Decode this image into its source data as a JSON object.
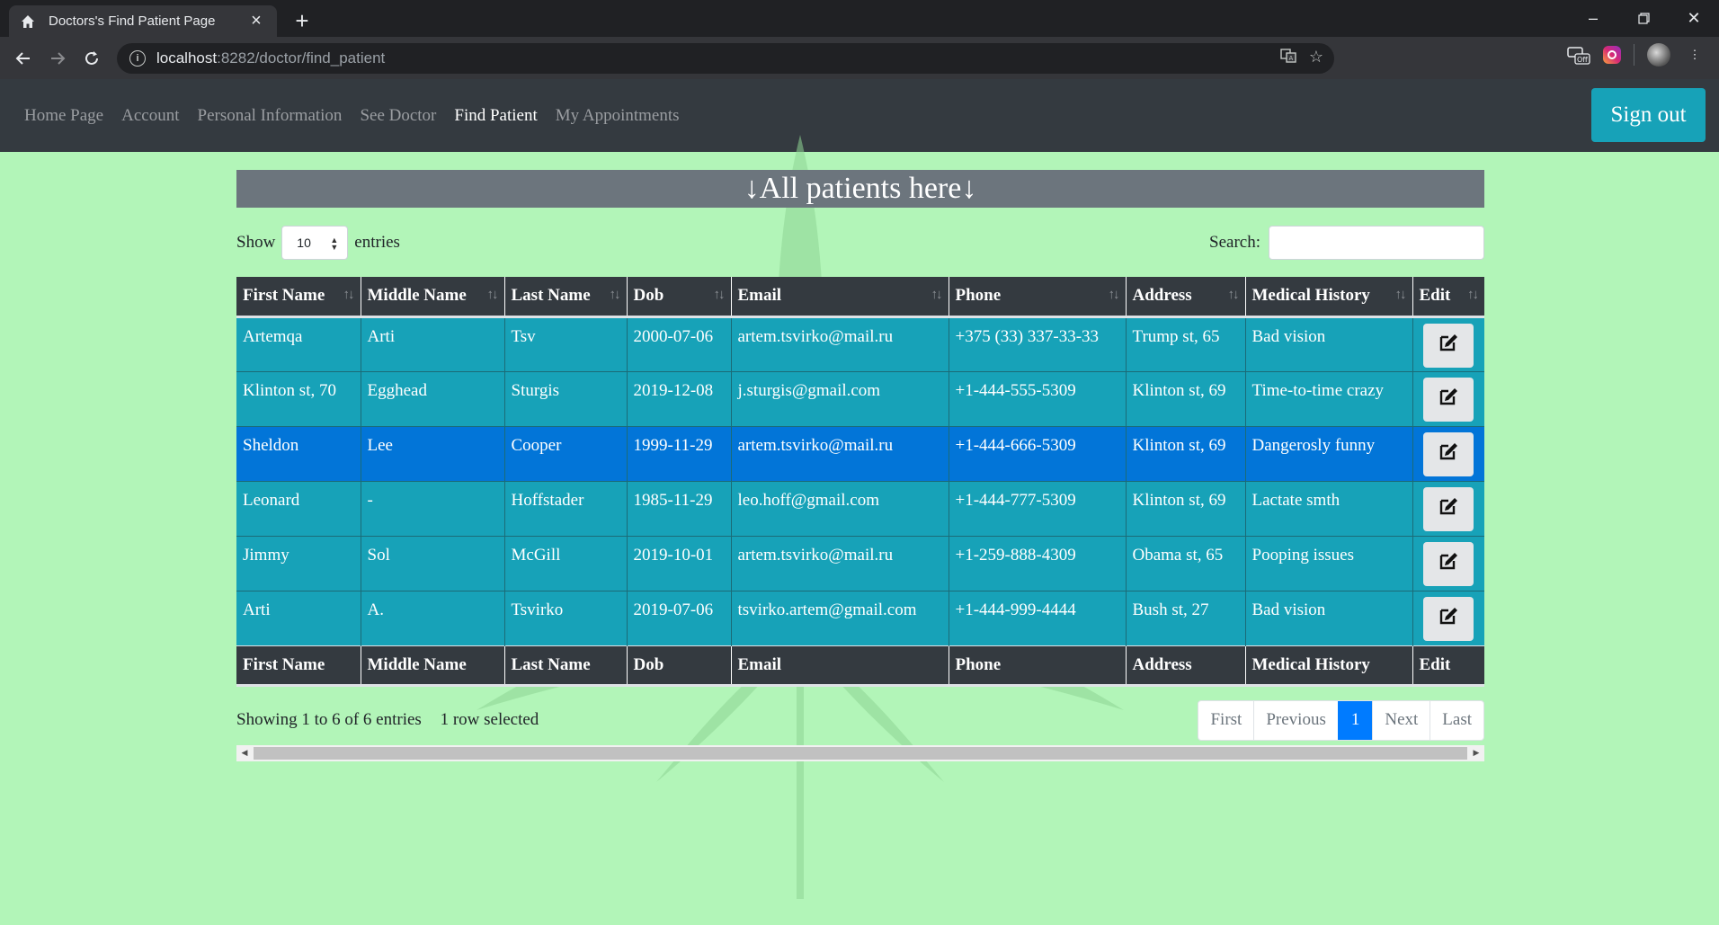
{
  "browser": {
    "tab_title": "Doctors's Find Patient Page",
    "url_host": "localhost",
    "url_rest": ":8282/doctor/find_patient",
    "ext_off_label": "Off"
  },
  "nav": {
    "links": [
      "Home Page",
      "Account",
      "Personal Information",
      "See Doctor",
      "Find Patient",
      "My Appointments"
    ],
    "active": "Find Patient",
    "signout_label": "Sign out"
  },
  "banner": "↓All patients here↓",
  "controls": {
    "show_label": "Show",
    "entries_value": "10",
    "entries_label": "entries",
    "search_label": "Search:",
    "search_value": ""
  },
  "table": {
    "columns": [
      "First Name",
      "Middle Name",
      "Last Name",
      "Dob",
      "Email",
      "Phone",
      "Address",
      "Medical History",
      "Edit"
    ],
    "rows": [
      [
        "Artemqa",
        "Arti",
        "Tsv",
        "2000-07-06",
        "artem.tsvirko@mail.ru",
        "+375 (33) 337-33-33",
        "Trump st, 65",
        "Bad vision"
      ],
      [
        "Klinton st, 70",
        "Egghead",
        "Sturgis",
        "2019-12-08",
        "j.sturgis@gmail.com",
        "+1-444-555-5309",
        "Klinton st, 69",
        "Time-to-time crazy"
      ],
      [
        "Sheldon",
        "Lee",
        "Cooper",
        "1999-11-29",
        "artem.tsvirko@mail.ru",
        "+1-444-666-5309",
        "Klinton st, 69",
        "Dangerosly funny"
      ],
      [
        "Leonard",
        "-",
        "Hoffstader",
        "1985-11-29",
        "leo.hoff@gmail.com",
        "+1-444-777-5309",
        "Klinton st, 69",
        "Lactate smth"
      ],
      [
        "Jimmy",
        "Sol",
        "McGill",
        "2019-10-01",
        "artem.tsvirko@mail.ru",
        "+1-259-888-4309",
        "Obama st, 65",
        "Pooping issues"
      ],
      [
        "Arti",
        "A.",
        "Tsvirko",
        "2019-07-06",
        "tsvirko.artem@gmail.com",
        "+1-444-999-4444",
        "Bush st, 27",
        "Bad vision"
      ]
    ],
    "selected_row": 2
  },
  "footer": {
    "info": "Showing 1 to 6 of 6 entries",
    "selected_info": "1 row selected",
    "pagination": [
      "First",
      "Previous",
      "1",
      "Next",
      "Last"
    ],
    "active_page": "1"
  },
  "colors": {
    "page_bg": "#b2f5b8",
    "navbar_bg": "#343a40",
    "row_bg": "#17a2b8",
    "selected_row_bg": "#0275d8",
    "banner_bg": "#6c757d",
    "primary": "#007bff"
  }
}
